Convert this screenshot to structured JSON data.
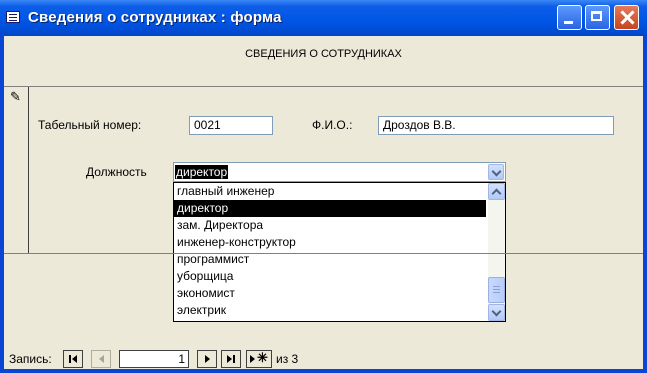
{
  "window": {
    "title": "Сведения о сотрудниках : форма"
  },
  "form": {
    "header": "СВЕДЕНИЯ О СОТРУДНИКАХ",
    "tab_number_label": "Табельный номер:",
    "tab_number_value": "0021",
    "fio_label": "Ф.И.О.:",
    "fio_value": "Дроздов В.В.",
    "position_label": "Должность",
    "position_value": "директор"
  },
  "dropdown": {
    "items": [
      "главный инженер",
      "директор",
      "зам. Директора",
      "инженер-конструктор",
      "программист",
      "уборщица",
      "экономист",
      "электрик"
    ],
    "selected_index": 1
  },
  "nav": {
    "label": "Запись:",
    "current": "1",
    "of_text": "из  3"
  }
}
